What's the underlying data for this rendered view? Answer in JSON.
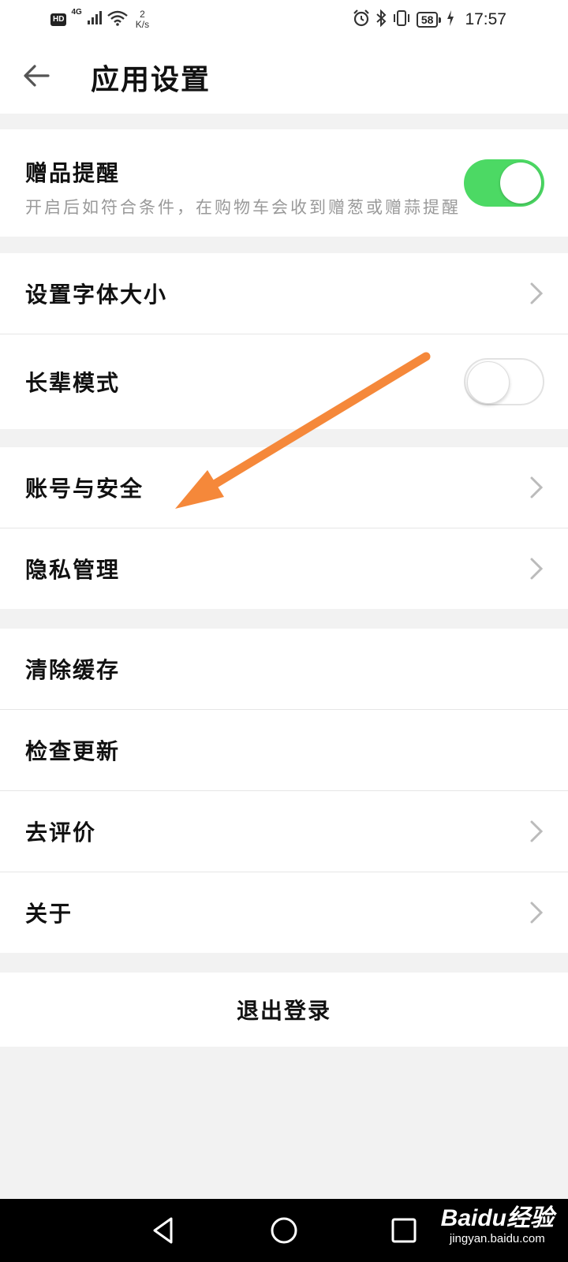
{
  "status_bar": {
    "hd": "HD",
    "network": "4G",
    "speed_value": "2",
    "speed_unit": "K/s",
    "battery": "58",
    "time": "17:57"
  },
  "header": {
    "title": "应用设置"
  },
  "gift_reminder": {
    "title": "赠品提醒",
    "description": "开启后如符合条件，在购物车会收到赠葱或赠蒜提醒",
    "enabled": true
  },
  "settings": {
    "font_size": "设置字体大小",
    "elder_mode": "长辈模式",
    "elder_mode_enabled": false,
    "account_security": "账号与安全",
    "privacy": "隐私管理",
    "clear_cache": "清除缓存",
    "check_update": "检查更新",
    "rate": "去评价",
    "about": "关于"
  },
  "logout": {
    "label": "退出登录"
  },
  "watermark": {
    "brand": "Baidu经验",
    "url": "jingyan.baidu.com"
  },
  "colors": {
    "toggle_on": "#4cd964",
    "annotation_arrow": "#f5883a"
  }
}
